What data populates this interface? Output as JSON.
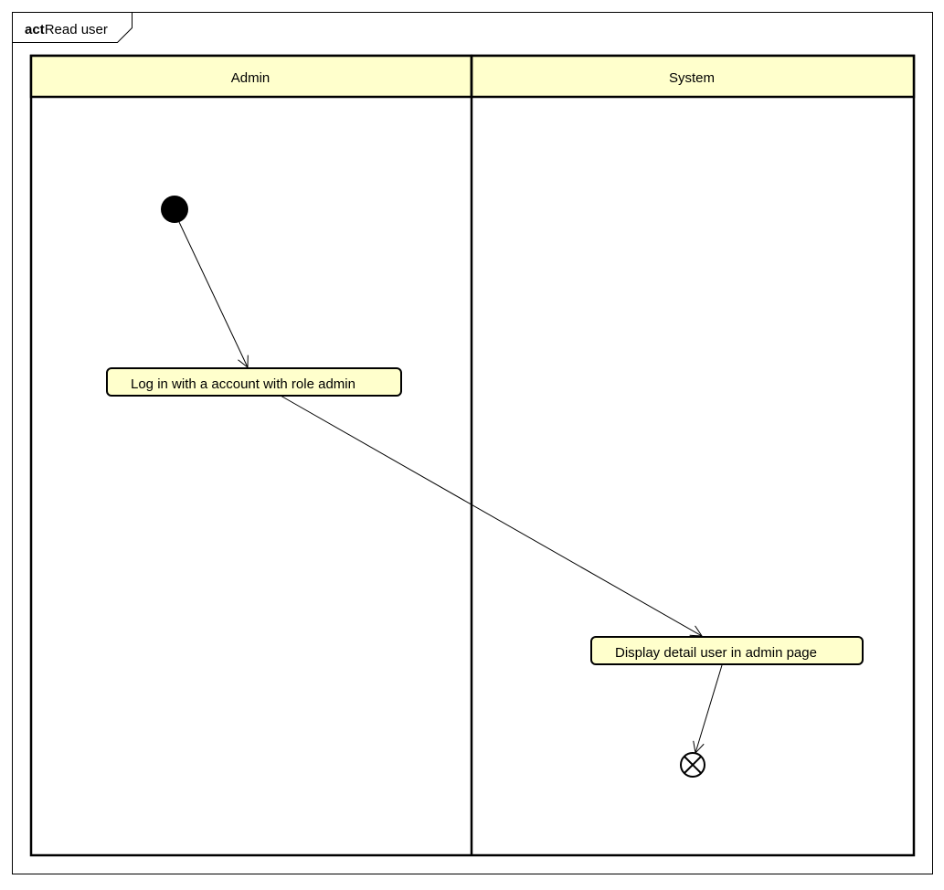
{
  "frame": {
    "keyword": "act",
    "title": "Read user"
  },
  "lanes": [
    {
      "label": "Admin"
    },
    {
      "label": "System"
    }
  ],
  "nodes": {
    "login": {
      "label": "Log in with a account with role admin"
    },
    "display": {
      "label": "Display detail user in admin page"
    }
  },
  "colors": {
    "lane_header_fill": "#ffffcc",
    "action_fill": "#ffffcc",
    "stroke": "#000000",
    "background": "#ffffff"
  }
}
